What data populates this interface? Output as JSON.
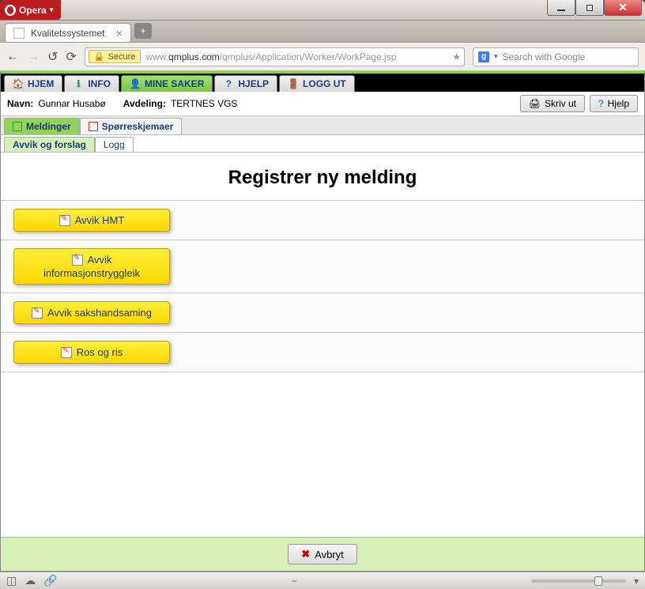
{
  "window": {
    "app_name": "Opera"
  },
  "tab": {
    "title": "Kvalitetssystemet"
  },
  "address": {
    "secure_label": "Secure",
    "url_prefix": "www.",
    "url_host": "qmplus.com",
    "url_path": "/qmplus/Application/Worker/WorkPage.jsp"
  },
  "search": {
    "placeholder": "Search with Google"
  },
  "appnav": {
    "hjem": "HJEM",
    "info": "INFO",
    "mine_saker": "MINE SAKER",
    "hjelp": "HJELP",
    "logg_ut": "LOGG UT"
  },
  "info": {
    "navn_label": "Navn:",
    "navn_value": "Gunnar Husabø",
    "avdeling_label": "Avdeling:",
    "avdeling_value": "TERTNES VGS",
    "skriv_ut": "Skriv ut",
    "hjelp": "Hjelp"
  },
  "subtabs": {
    "meldinger": "Meldinger",
    "sporreskjemaer": "Spørreskjemaer"
  },
  "subtabs2": {
    "avvik_og_forslag": "Avvik og forslag",
    "logg": "Logg"
  },
  "page": {
    "title": "Registrer ny melding"
  },
  "categories": [
    {
      "label": "Avvik HMT"
    },
    {
      "label_line1": "Avvik",
      "label_line2": "informasjonstryggleik"
    },
    {
      "label": "Avvik sakshandsaming"
    },
    {
      "label": "Ros og ris"
    }
  ],
  "footer": {
    "avbryt": "Avbryt"
  }
}
